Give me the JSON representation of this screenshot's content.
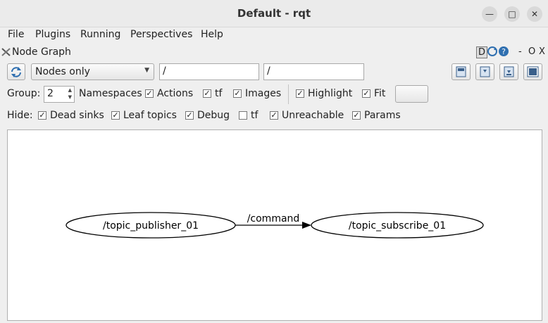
{
  "window": {
    "title": "Default - rqt"
  },
  "menubar": {
    "items": [
      "File",
      "Plugins",
      "Running",
      "Perspectives",
      "Help"
    ]
  },
  "plugin": {
    "title": "Node Graph",
    "header_controls": [
      "D",
      "-",
      "O",
      "X"
    ]
  },
  "toolbar": {
    "mode_select": "Nodes only",
    "node_filter_value": "/",
    "topic_filter_value": "/"
  },
  "group_row": {
    "group_label": "Group:",
    "group_value": "2",
    "namespaces": {
      "label": "Namespaces",
      "checked": true
    },
    "actions": {
      "label": "Actions",
      "checked": true
    },
    "tf": {
      "label": "tf",
      "checked": true
    },
    "images": {
      "label": "Images",
      "checked": true
    },
    "highlight": {
      "label": "Highlight",
      "checked": true
    },
    "fit": {
      "label": "Fit",
      "checked": true
    }
  },
  "hide_row": {
    "label": "Hide:",
    "dead_sinks": {
      "label": "Dead sinks",
      "checked": true
    },
    "leaf_topics": {
      "label": "Leaf topics",
      "checked": true
    },
    "debug": {
      "label": "Debug",
      "checked": true
    },
    "tf": {
      "label": "tf",
      "checked": false
    },
    "unreachable": {
      "label": "Unreachable",
      "checked": true
    },
    "params": {
      "label": "Params",
      "checked": true
    }
  },
  "graph": {
    "nodes": [
      {
        "id": "pub",
        "label": "/topic_publisher_01"
      },
      {
        "id": "sub",
        "label": "/topic_subscribe_01"
      }
    ],
    "edges": [
      {
        "from": "pub",
        "to": "sub",
        "label": "/command"
      }
    ]
  }
}
